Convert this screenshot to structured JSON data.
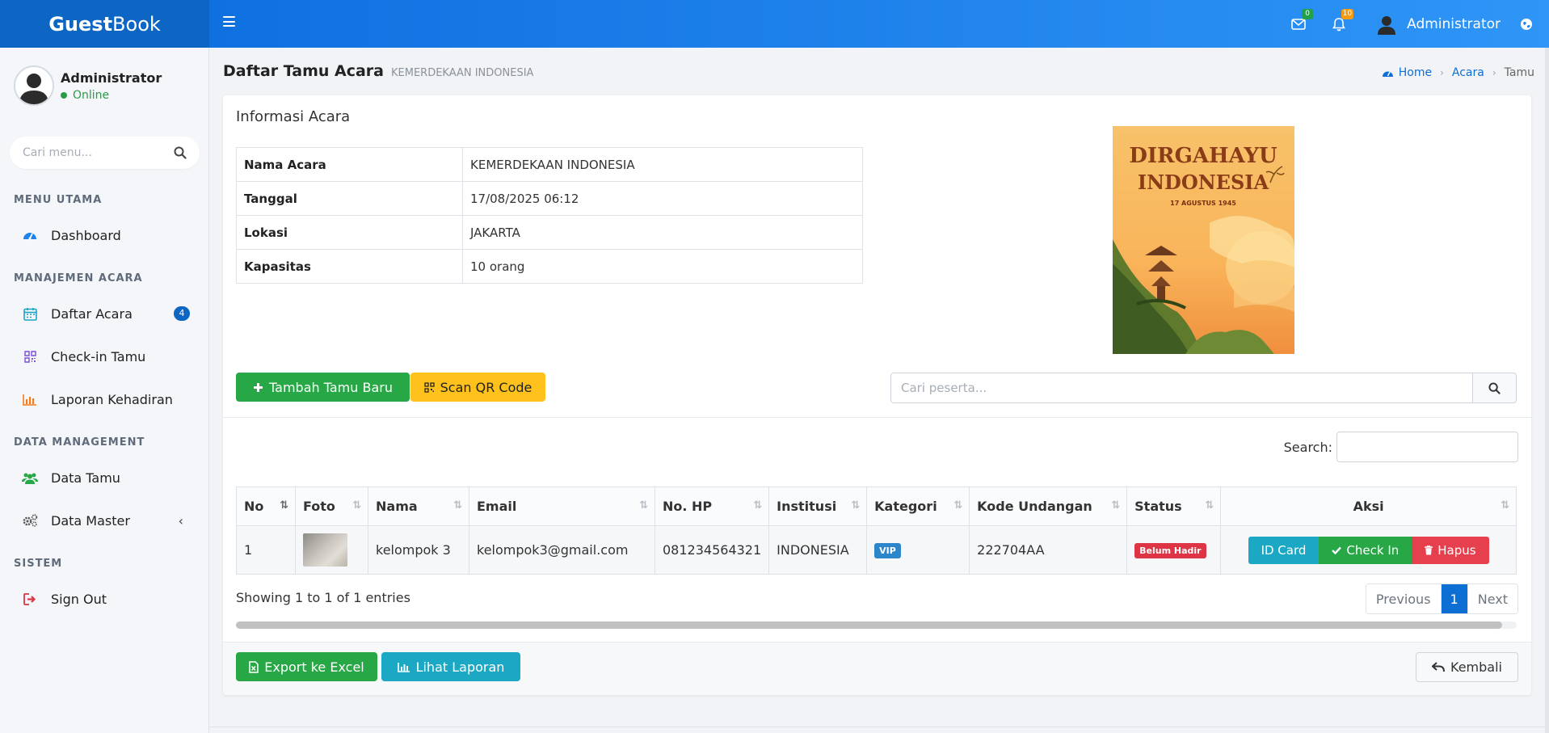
{
  "brand": {
    "bold": "Guest",
    "light": "Book"
  },
  "navbar": {
    "messages_count": "0",
    "notifications_count": "10",
    "user_name": "Administrator"
  },
  "sidebar": {
    "user": {
      "name": "Administrator",
      "status": "Online"
    },
    "search_placeholder": "Cari menu...",
    "sections": {
      "main": "MENU UTAMA",
      "events": "MANAJEMEN ACARA",
      "data": "DATA MANAGEMENT",
      "system": "SISTEM"
    },
    "items": {
      "dashboard": "Dashboard",
      "events": "Daftar Acara",
      "events_badge": "4",
      "checkin": "Check-in Tamu",
      "report": "Laporan Kehadiran",
      "guests": "Data Tamu",
      "master": "Data Master",
      "signout": "Sign Out"
    }
  },
  "header": {
    "title": "Daftar Tamu Acara",
    "subtitle": "KEMERDEKAAN INDONESIA",
    "breadcrumb": [
      "Home",
      "Acara",
      "Tamu"
    ]
  },
  "event_info": {
    "title": "Informasi Acara",
    "rows": [
      {
        "label": "Nama Acara",
        "value": "KEMERDEKAAN INDONESIA"
      },
      {
        "label": "Tanggal",
        "value": "17/08/2025 06:12"
      },
      {
        "label": "Lokasi",
        "value": "JAKARTA"
      },
      {
        "label": "Kapasitas",
        "value": "10 orang"
      }
    ],
    "poster": {
      "line1": "DIRGAHAYU",
      "line2": "INDONESIA",
      "line3": "17 AGUSTUS 1945"
    }
  },
  "actions": {
    "add_guest": "Tambah Tamu Baru",
    "scan_qr": "Scan QR Code",
    "search_placeholder": "Cari peserta..."
  },
  "table": {
    "search_label": "Search:",
    "columns": [
      "No",
      "Foto",
      "Nama",
      "Email",
      "No. HP",
      "Institusi",
      "Kategori",
      "Kode Undangan",
      "Status",
      "Aksi"
    ],
    "rows": [
      {
        "no": "1",
        "nama": "kelompok 3",
        "email": "kelompok3@gmail.com",
        "hp": "081234564321",
        "institusi": "INDONESIA",
        "kategori": "VIP",
        "kode": "222704AA",
        "status": "Belum Hadir",
        "buttons": {
          "id_card": "ID Card",
          "check_in": "Check In",
          "delete": "Hapus"
        }
      }
    ],
    "info": "Showing 1 to 1 of 1 entries",
    "pagination": {
      "prev": "Previous",
      "page": "1",
      "next": "Next"
    }
  },
  "footer": {
    "export": "Export ke Excel",
    "report": "Lihat Laporan",
    "back": "Kembali"
  }
}
